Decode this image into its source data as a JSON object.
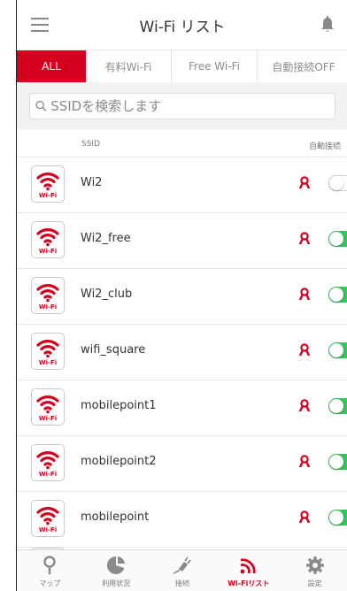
{
  "header": {
    "title": "Wi-Fi リスト"
  },
  "tabs": [
    {
      "label": "ALL"
    },
    {
      "label": "有料Wi-Fi"
    },
    {
      "label": "Free Wi-Fi"
    },
    {
      "label": "自動接続OFF"
    }
  ],
  "search": {
    "placeholder": "SSIDを検索します"
  },
  "columns": {
    "ssid": "SSID",
    "auto_connect": "自動接続"
  },
  "networks": [
    {
      "ssid": "Wi2",
      "auto_connect": false
    },
    {
      "ssid": "Wi2_free",
      "auto_connect": true
    },
    {
      "ssid": "Wi2_club",
      "auto_connect": true
    },
    {
      "ssid": "wifi_square",
      "auto_connect": true
    },
    {
      "ssid": "mobilepoint1",
      "auto_connect": true
    },
    {
      "ssid": "mobilepoint2",
      "auto_connect": true
    },
    {
      "ssid": "mobilepoint",
      "auto_connect": true
    }
  ],
  "wifi_badge_label": "Wi-Fi",
  "bottom_nav": [
    {
      "label": "マップ",
      "icon": "map-pin-icon"
    },
    {
      "label": "利用状況",
      "icon": "usage-pie-icon"
    },
    {
      "label": "接続",
      "icon": "plug-icon"
    },
    {
      "label": "Wi-Fiリスト",
      "icon": "wifi-signal-icon",
      "active": true
    },
    {
      "label": "設定",
      "icon": "gear-icon"
    }
  ],
  "colors": {
    "brand_red": "#d4001e",
    "toggle_on": "#34c759",
    "icon_gray": "#8a8a8a"
  }
}
